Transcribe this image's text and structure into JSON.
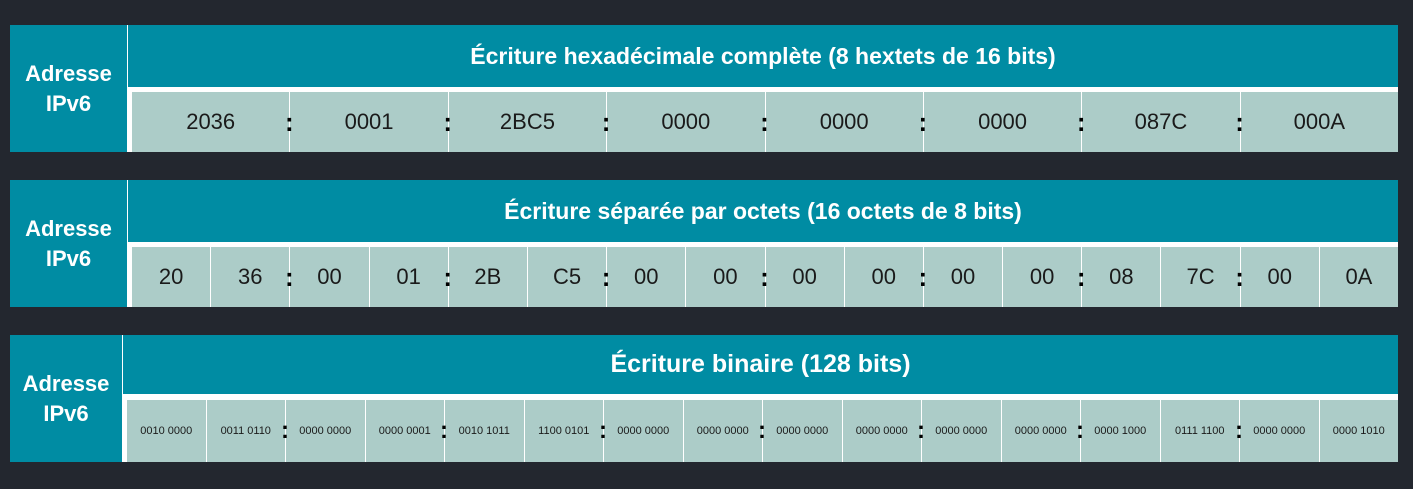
{
  "blocks": [
    {
      "side_line1": "Adresse",
      "side_line2": "IPv6",
      "title": "Écriture hexadécimale complète (8 hextets de 16 bits)",
      "cells": [
        "2036",
        "0001",
        "2BC5",
        "0000",
        "0000",
        "0000",
        "087C",
        "000A"
      ],
      "separator": ":"
    },
    {
      "side_line1": "Adresse",
      "side_line2": "IPv6",
      "title": "Écriture séparée par octets (16 octets de 8 bits)",
      "cells": [
        "20",
        "36",
        "00",
        "01",
        "2B",
        "C5",
        "00",
        "00",
        "00",
        "00",
        "00",
        "00",
        "08",
        "7C",
        "00",
        "0A"
      ],
      "separator": ":"
    },
    {
      "side_line1": "Adresse",
      "side_line2": "IPv6",
      "title": "Écriture binaire (128 bits)",
      "cells": [
        "0010 0000",
        "0011 0110",
        "0000 0000",
        "0000 0001",
        "0010 1011",
        "1100 0101",
        "0000 0000",
        "0000 0000",
        "0000 0000",
        "0000 0000",
        "0000 0000",
        "0000 0000",
        "0000 1000",
        "0111 1100",
        "0000 0000",
        "0000 1010"
      ],
      "separator": ":"
    }
  ],
  "colors": {
    "background": "#23272f",
    "header": "#008ca3",
    "cell": "#acccc8"
  }
}
